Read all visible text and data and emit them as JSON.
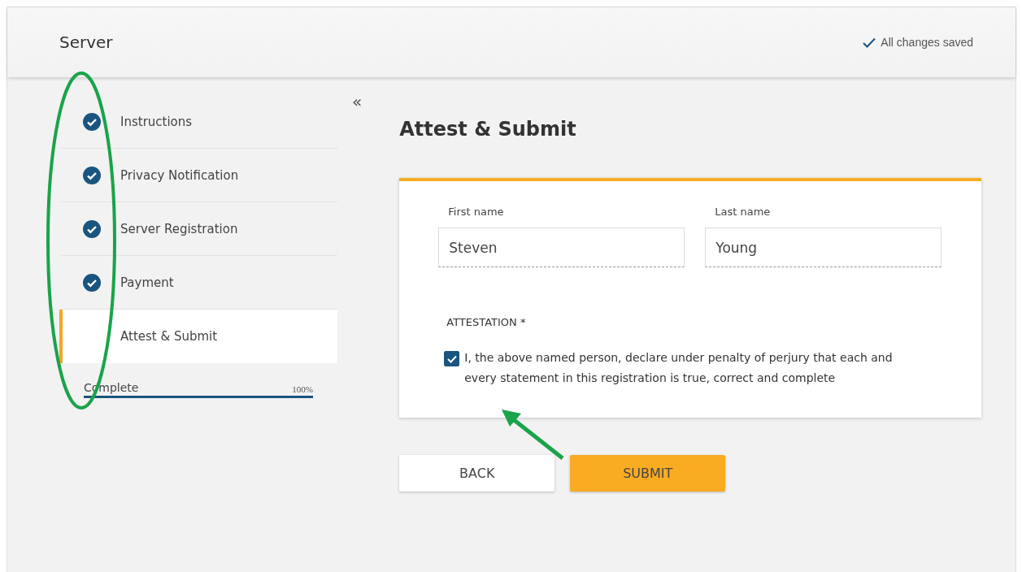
{
  "header": {
    "title": "Server",
    "save_status": "All changes saved"
  },
  "steps": [
    {
      "label": "Instructions",
      "done": true,
      "selected": false
    },
    {
      "label": "Privacy Notification",
      "done": true,
      "selected": false
    },
    {
      "label": "Server Registration",
      "done": true,
      "selected": false
    },
    {
      "label": "Payment",
      "done": true,
      "selected": false
    },
    {
      "label": "Attest & Submit",
      "done": false,
      "selected": true
    }
  ],
  "progress": {
    "label": "Complete",
    "reading": "100%",
    "level": 1
  },
  "collapse": "«",
  "main": {
    "title": "Attest & Submit",
    "fields": [
      {
        "label": "First name",
        "value": "Steven"
      },
      {
        "label": "Last name",
        "value": "Young"
      }
    ],
    "attestation": {
      "heading": "ATTESTATION",
      "required_mark": "*",
      "checked": true,
      "text": "I, the above named person, declare under penalty of perjury that each and every statement in this registration is true, correct and complete"
    },
    "buttons": [
      {
        "label": "BACK",
        "kind": "secondary"
      },
      {
        "label": "SUBMIT",
        "kind": "primary"
      }
    ]
  }
}
